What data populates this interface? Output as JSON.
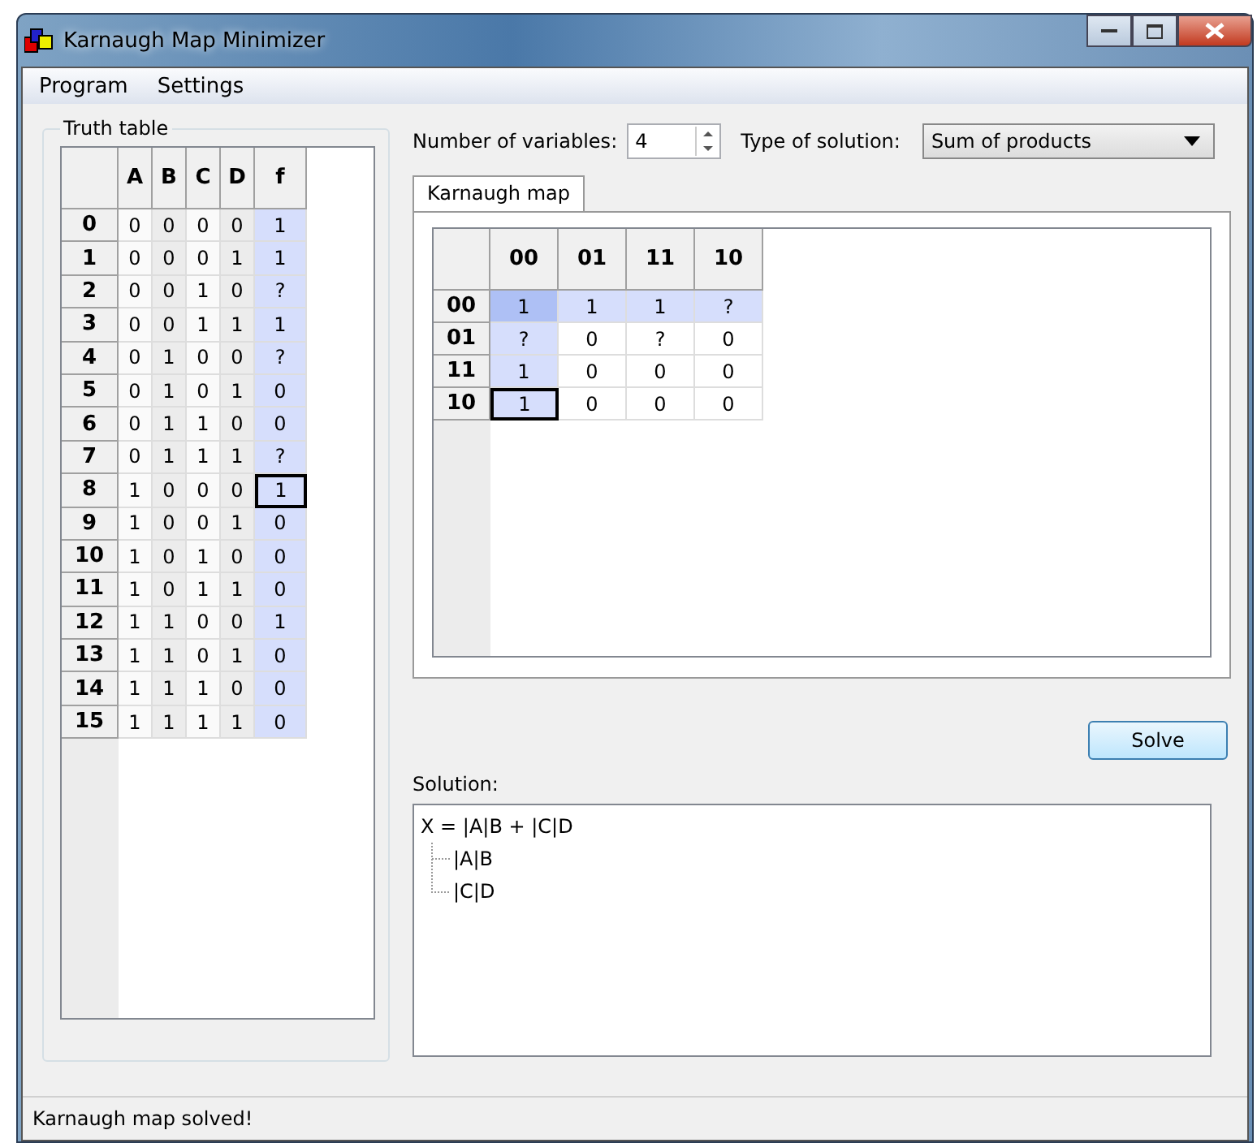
{
  "window": {
    "title": "Karnaugh Map Minimizer"
  },
  "menu": [
    "Program",
    "Settings"
  ],
  "truth_table": {
    "title": "Truth table",
    "columns": [
      "A",
      "B",
      "C",
      "D",
      "f"
    ],
    "rows": [
      {
        "index": "0",
        "values": [
          "0",
          "0",
          "0",
          "0"
        ],
        "f": "1",
        "focused": false
      },
      {
        "index": "1",
        "values": [
          "0",
          "0",
          "0",
          "1"
        ],
        "f": "1",
        "focused": false
      },
      {
        "index": "2",
        "values": [
          "0",
          "0",
          "1",
          "0"
        ],
        "f": "?",
        "focused": false
      },
      {
        "index": "3",
        "values": [
          "0",
          "0",
          "1",
          "1"
        ],
        "f": "1",
        "focused": false
      },
      {
        "index": "4",
        "values": [
          "0",
          "1",
          "0",
          "0"
        ],
        "f": "?",
        "focused": false
      },
      {
        "index": "5",
        "values": [
          "0",
          "1",
          "0",
          "1"
        ],
        "f": "0",
        "focused": false
      },
      {
        "index": "6",
        "values": [
          "0",
          "1",
          "1",
          "0"
        ],
        "f": "0",
        "focused": false
      },
      {
        "index": "7",
        "values": [
          "0",
          "1",
          "1",
          "1"
        ],
        "f": "?",
        "focused": false
      },
      {
        "index": "8",
        "values": [
          "1",
          "0",
          "0",
          "0"
        ],
        "f": "1",
        "focused": true
      },
      {
        "index": "9",
        "values": [
          "1",
          "0",
          "0",
          "1"
        ],
        "f": "0",
        "focused": false
      },
      {
        "index": "10",
        "values": [
          "1",
          "0",
          "1",
          "0"
        ],
        "f": "0",
        "focused": false
      },
      {
        "index": "11",
        "values": [
          "1",
          "0",
          "1",
          "1"
        ],
        "f": "0",
        "focused": false
      },
      {
        "index": "12",
        "values": [
          "1",
          "1",
          "0",
          "0"
        ],
        "f": "1",
        "focused": false
      },
      {
        "index": "13",
        "values": [
          "1",
          "1",
          "0",
          "1"
        ],
        "f": "0",
        "focused": false
      },
      {
        "index": "14",
        "values": [
          "1",
          "1",
          "1",
          "0"
        ],
        "f": "0",
        "focused": false
      },
      {
        "index": "15",
        "values": [
          "1",
          "1",
          "1",
          "1"
        ],
        "f": "0",
        "focused": false
      }
    ]
  },
  "variables": {
    "label": "Number of variables:",
    "value": "4"
  },
  "solution_type": {
    "label": "Type of solution:",
    "value": "Sum of products"
  },
  "tabs": [
    {
      "label": "Karnaugh map",
      "selected": true
    }
  ],
  "karnaugh_map": {
    "columns": [
      "00",
      "01",
      "11",
      "10"
    ],
    "rows": [
      {
        "label": "00",
        "cells": [
          {
            "value": "1",
            "highlighted": true,
            "selected": true,
            "focused": false
          },
          {
            "value": "1",
            "highlighted": true,
            "selected": false,
            "focused": false
          },
          {
            "value": "1",
            "highlighted": true,
            "selected": false,
            "focused": false
          },
          {
            "value": "?",
            "highlighted": true,
            "selected": false,
            "focused": false
          }
        ]
      },
      {
        "label": "01",
        "cells": [
          {
            "value": "?",
            "highlighted": true,
            "selected": false,
            "focused": false
          },
          {
            "value": "0",
            "highlighted": false,
            "selected": false,
            "focused": false
          },
          {
            "value": "?",
            "highlighted": false,
            "selected": false,
            "focused": false
          },
          {
            "value": "0",
            "highlighted": false,
            "selected": false,
            "focused": false
          }
        ]
      },
      {
        "label": "11",
        "cells": [
          {
            "value": "1",
            "highlighted": true,
            "selected": false,
            "focused": false
          },
          {
            "value": "0",
            "highlighted": false,
            "selected": false,
            "focused": false
          },
          {
            "value": "0",
            "highlighted": false,
            "selected": false,
            "focused": false
          },
          {
            "value": "0",
            "highlighted": false,
            "selected": false,
            "focused": false
          }
        ]
      },
      {
        "label": "10",
        "cells": [
          {
            "value": "1",
            "highlighted": true,
            "selected": false,
            "focused": true
          },
          {
            "value": "0",
            "highlighted": false,
            "selected": false,
            "focused": false
          },
          {
            "value": "0",
            "highlighted": false,
            "selected": false,
            "focused": false
          },
          {
            "value": "0",
            "highlighted": false,
            "selected": false,
            "focused": false
          }
        ]
      }
    ]
  },
  "solve_button": "Solve",
  "solution": {
    "label": "Solution:",
    "tree": [
      {
        "text": "X = |A|B + |C|D",
        "children": [
          {
            "text": "|A|B"
          },
          {
            "text": "|C|D"
          }
        ]
      }
    ]
  },
  "status_bar": "Karnaugh map solved!"
}
